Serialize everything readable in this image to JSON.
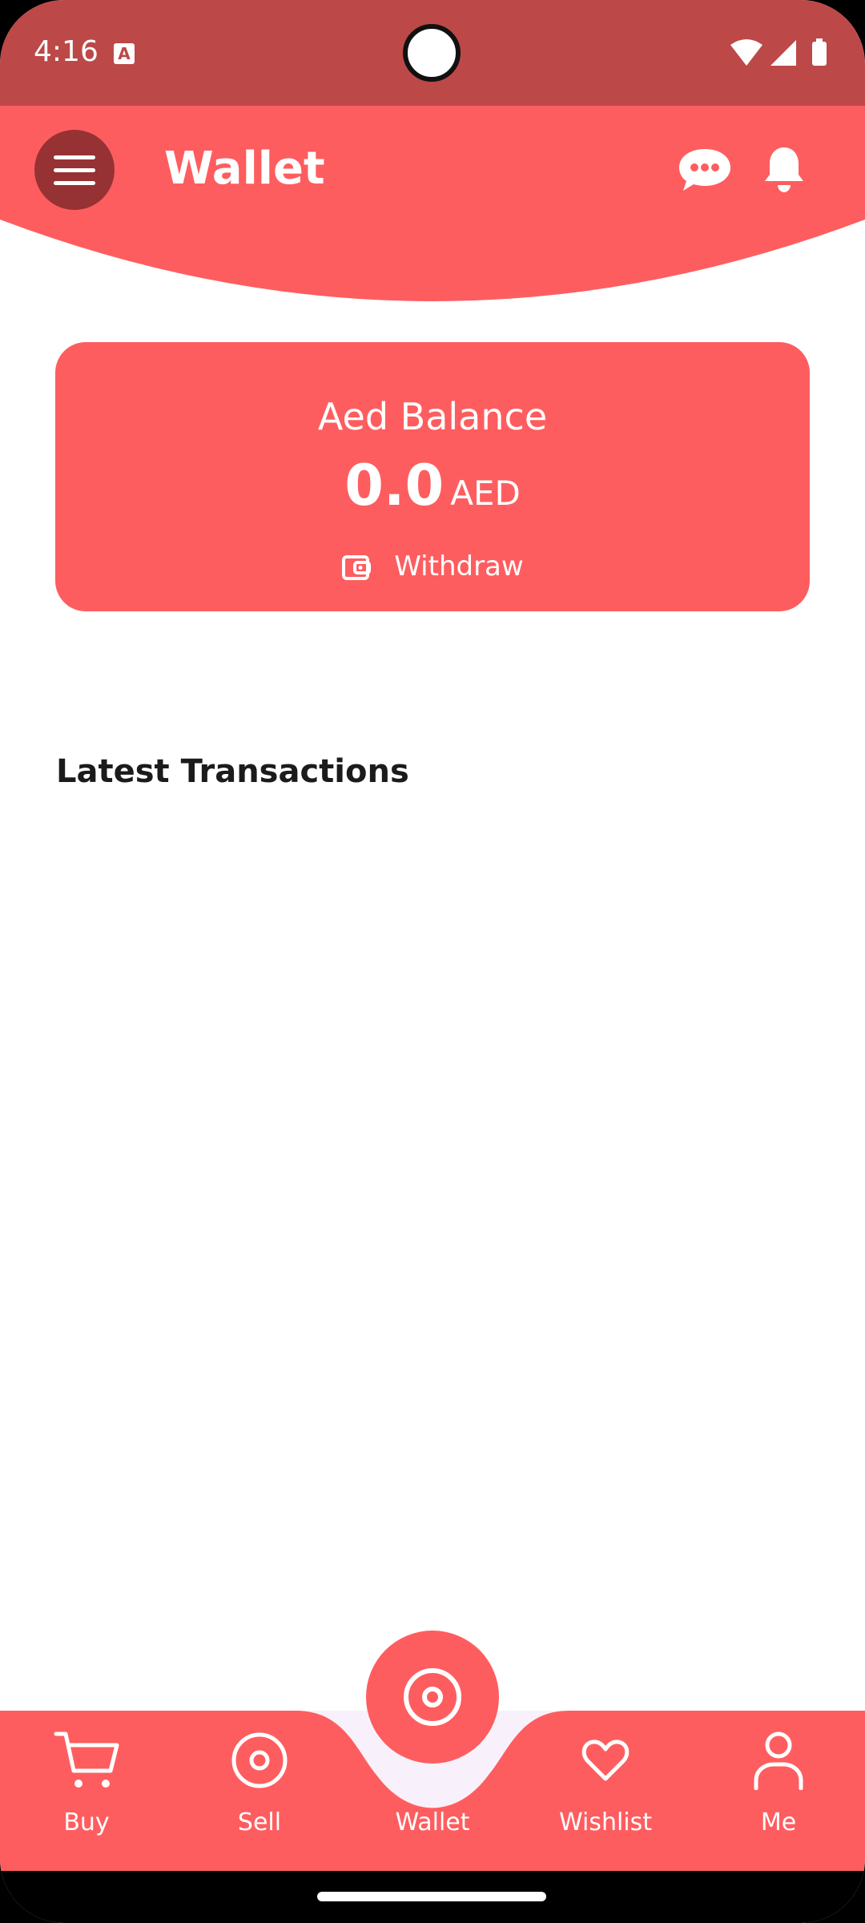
{
  "status_bar": {
    "time": "4:16",
    "notification_icon": "A"
  },
  "appbar": {
    "title": "Wallet"
  },
  "balance_card": {
    "label": "Aed Balance",
    "amount": "0.0",
    "currency": "AED",
    "withdraw_label": "Withdraw"
  },
  "transactions": {
    "title": "Latest Transactions"
  },
  "bottom_nav": {
    "items": [
      {
        "label": "Buy",
        "icon": "cart-icon"
      },
      {
        "label": "Sell",
        "icon": "target-icon"
      },
      {
        "label": "Wallet",
        "icon": "target-icon"
      },
      {
        "label": "Wishlist",
        "icon": "heart-icon"
      },
      {
        "label": "Me",
        "icon": "person-icon"
      }
    ]
  },
  "colors": {
    "primary": "#fe5d5f",
    "status_bar": "#bd4848",
    "menu_button": "#963233"
  }
}
